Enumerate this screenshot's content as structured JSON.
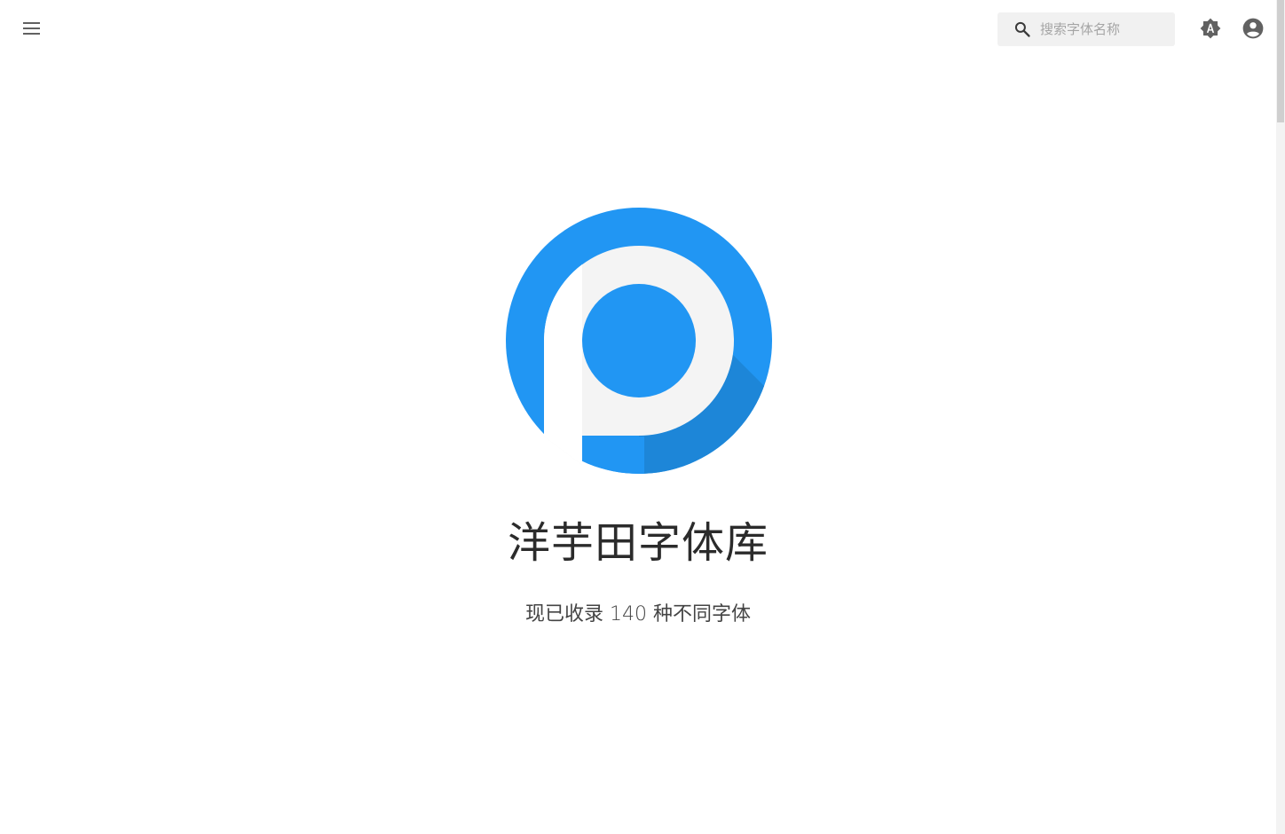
{
  "header": {
    "menu_icon": "menu-icon",
    "search": {
      "placeholder": "搜索字体名称",
      "value": "",
      "icon": "search-icon"
    },
    "theme_icon": "brightness-auto-icon",
    "account_icon": "account-circle-icon"
  },
  "hero": {
    "title": "洋芋田字体库",
    "subtitle": "现已收录 140 种不同字体"
  },
  "colors": {
    "brand_blue": "#2196f3",
    "shadow_blue": "#1d86d8",
    "icon_gray": "#616161"
  }
}
